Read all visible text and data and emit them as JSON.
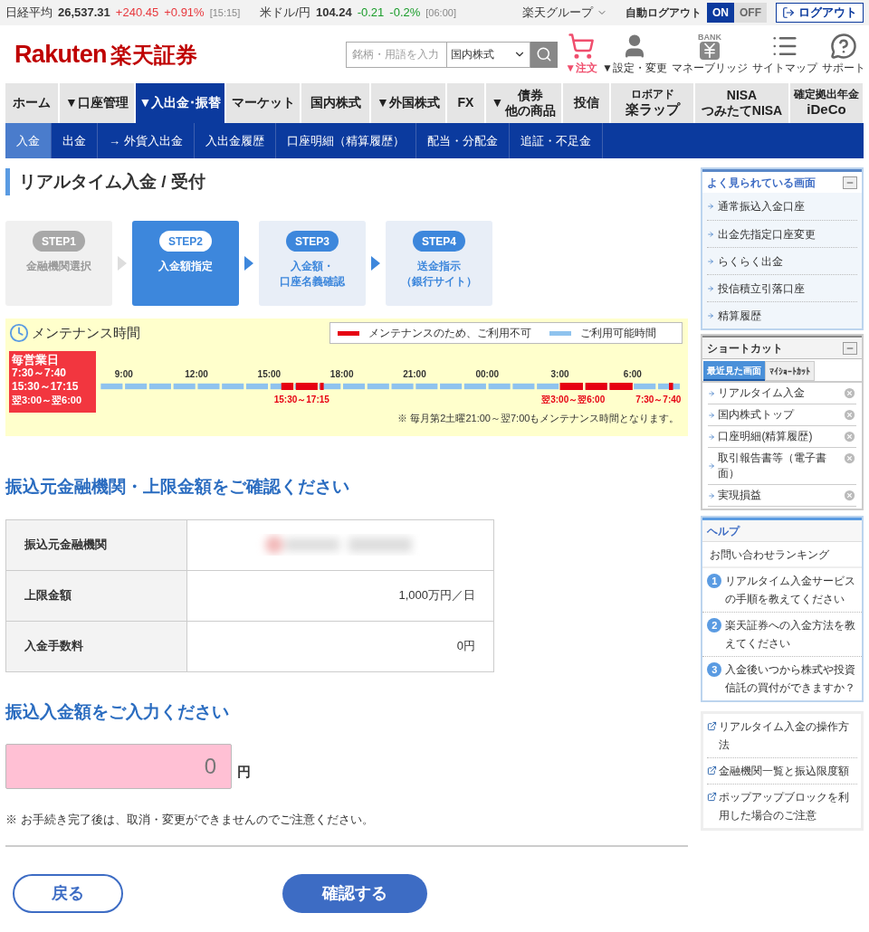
{
  "ticker": [
    {
      "name": "日経平均",
      "value": "26,537.31",
      "change": "+240.45",
      "percent": "+0.91%",
      "time": "[15:15]",
      "color": "#e8383d"
    },
    {
      "name": "米ドル/円",
      "value": "104.24",
      "change": "-0.21",
      "percent": "-0.2%",
      "time": "[06:00]",
      "color": "#1a9c2a"
    }
  ],
  "group_menu": "楽天グループ",
  "auto_logout": {
    "label": "自動ログアウト",
    "on_label": "ON",
    "off_label": "OFF",
    "on": true
  },
  "logout_button": "ログアウト",
  "logo": {
    "latin": "Rakuten",
    "japanese": "楽天証券"
  },
  "search": {
    "placeholder": "銘柄・用語を入力",
    "category": "国内株式"
  },
  "header_icons": [
    {
      "kind": "cart",
      "label": "▼注文"
    },
    {
      "kind": "person",
      "label": "▼設定・変更"
    },
    {
      "kind": "bank",
      "label": "マネーブリッジ",
      "badge": "BANK"
    },
    {
      "kind": "sitemap",
      "label": "サイトマップ"
    },
    {
      "kind": "support",
      "label": "サポート"
    }
  ],
  "nav_tabs": [
    {
      "label": "ホーム",
      "selected": false
    },
    {
      "label": "▼口座管理",
      "selected": false
    },
    {
      "label": "▼入出金･振替",
      "selected": true
    },
    {
      "label": "マーケット",
      "selected": false
    },
    {
      "label": "国内株式",
      "selected": false
    },
    {
      "label": "▼外国株式",
      "selected": false
    },
    {
      "label": "FX",
      "selected": false
    },
    {
      "label": "▼",
      "lines": [
        "債券",
        "他の商品"
      ],
      "selected": false
    },
    {
      "label": "投信",
      "selected": false
    },
    {
      "small": "ロボアド",
      "label": "楽ラップ",
      "selected": false
    },
    {
      "lines": [
        "NISA",
        "つみたてNISA"
      ],
      "selected": false
    },
    {
      "small": "確定拠出年金",
      "label": "iDeCo",
      "selected": false
    }
  ],
  "sub_nav": [
    {
      "label": "入金",
      "selected": true
    },
    {
      "label": "出金",
      "selected": false
    },
    {
      "label": "→ 外貨入出金",
      "selected": false
    },
    {
      "label": "入出金履歴",
      "selected": false
    },
    {
      "label": "口座明細（精算履歴）",
      "selected": false
    },
    {
      "label": "配当・分配金",
      "selected": false
    },
    {
      "label": "追証・不足金",
      "selected": false
    }
  ],
  "page_title": "リアルタイム入金 / 受付",
  "steps": [
    {
      "badge": "STEP1",
      "lines": [
        "金融機関選択"
      ],
      "selected": false,
      "disabled": true
    },
    {
      "badge": "STEP2",
      "lines": [
        "入金額指定"
      ],
      "selected": true,
      "disabled": false
    },
    {
      "badge": "STEP3",
      "lines": [
        "入金額・",
        "口座名義確認"
      ],
      "selected": false,
      "disabled": false
    },
    {
      "badge": "STEP4",
      "lines": [
        "送金指示",
        "（銀行サイト）"
      ],
      "selected": false,
      "disabled": false
    }
  ],
  "maintenance": {
    "title": "メンテナンス時間",
    "legend_unavailable": "メンテナンスのため、ご利用不可",
    "legend_available": "ご利用可能時間",
    "daily_title": "毎営業日",
    "daily_times": [
      "7:30～7:40",
      "15:30～17:15",
      "翌3:00～翌6:00"
    ],
    "ticks": [
      "9:00",
      "12:00",
      "15:00",
      "18:00",
      "21:00",
      "00:00",
      "3:00",
      "6:00"
    ],
    "range_labels": [
      "15:30～17:15",
      "翌3:00～翌6:00",
      "7:30～7:40"
    ],
    "note": "※ 毎月第2土曜21:00～翌7:00もメンテナンス時間となります。"
  },
  "section1_title": "振込元金融機関・上限金額をご確認ください",
  "info_table": [
    {
      "label": "振込元金融機関",
      "kind": "redacted"
    },
    {
      "label": "上限金額",
      "kind": "text",
      "value": "1,000万円／日"
    },
    {
      "label": "入金手数料",
      "kind": "text",
      "value": "0円"
    }
  ],
  "section2_title": "振込入金額をご入力ください",
  "amount": {
    "value": "0",
    "unit": "円"
  },
  "notice": "※ お手続き完了後は、取消・変更ができませんのでご注意ください。",
  "buttons": {
    "back": "戻る",
    "confirm": "確認する"
  },
  "sidebar": {
    "popular": {
      "title": "よく見られている画面",
      "items": [
        "通常振込入金口座",
        "出金先指定口座変更",
        "らくらく出金",
        "投信積立引落口座",
        "精算履歴"
      ]
    },
    "shortcut": {
      "title": "ショートカット",
      "tabs": [
        {
          "label": "最近見た画面",
          "selected": true
        },
        {
          "label": "ﾏｲｼｮｰﾄｶｯﾄ",
          "selected": false
        }
      ],
      "items": [
        "リアルタイム入金",
        "国内株式トップ",
        "口座明細(精算履歴)",
        "取引報告書等（電子書面）",
        "実現損益"
      ]
    },
    "help": {
      "title": "ヘルプ",
      "subtitle": "お問い合わせランキング",
      "items": [
        {
          "rank": "1",
          "text": "リアルタイム入金サービスの手順を教えてください"
        },
        {
          "rank": "2",
          "text": "楽天証券への入金方法を教えてください"
        },
        {
          "rank": "3",
          "text": "入金後いつから株式や投資信託の買付ができますか？"
        }
      ]
    },
    "links": [
      "リアルタイム入金の操作方法",
      "金融機関一覧と振込限度額",
      "ポップアップブロックを利用した場合のご注意"
    ]
  }
}
